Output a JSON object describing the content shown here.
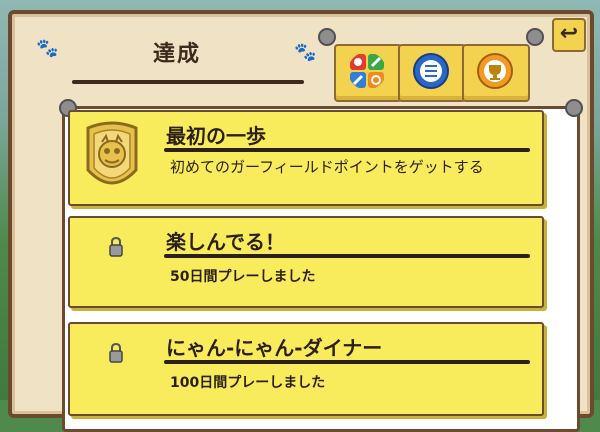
{
  "header": {
    "title": "達成",
    "back_label": "↩"
  },
  "tabs": [
    {
      "name": "all-categories",
      "icon": "category-grid-icon"
    },
    {
      "name": "list-view",
      "icon": "list-emblem-icon"
    },
    {
      "name": "trophy-view",
      "icon": "trophy-emblem-icon"
    }
  ],
  "achievements": [
    {
      "title": "最初の一歩",
      "description": "初めてのガーフィールドポイントをゲットする",
      "unlocked": true,
      "icon": "garfield-medal-icon"
    },
    {
      "title": "楽しんでる！",
      "description": "50日間プレーしました",
      "unlocked": false,
      "icon": "lock-icon"
    },
    {
      "title": "にゃん-にゃん-ダイナー",
      "description": "100日間プレーしました",
      "unlocked": false,
      "icon": "lock-icon"
    }
  ],
  "colors": {
    "card": "#f8ec5c",
    "border": "#6b4a30",
    "board": "#f0e2c4",
    "text": "#2b1f16"
  }
}
